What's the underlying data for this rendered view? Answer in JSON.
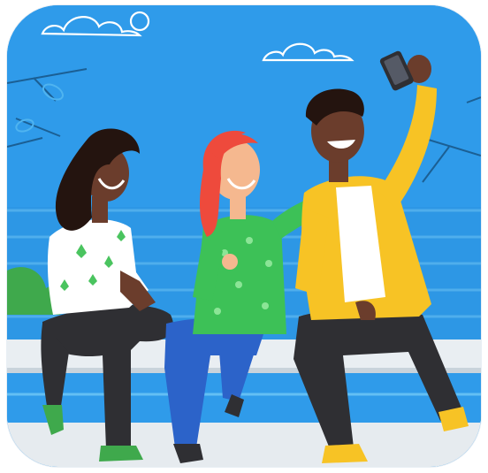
{
  "app_icon": {
    "name": "selfie-illustration-app-icon",
    "colors": {
      "sky": "#2f9bea",
      "water_line": "#5cb8f2",
      "bench": "#e9eef2",
      "shrub": "#3fa94c",
      "skin_dark": "#6b3d2c",
      "skin_light": "#f5b88f",
      "hair_red": "#ee4a3c",
      "shirt_green": "#3dc157",
      "jacket_yellow": "#f7c325",
      "pants_dark": "#2f2f33",
      "jeans_blue": "#2c63c9"
    },
    "people": [
      "woman-white-floral-shirt",
      "woman-red-hair-green-shirt",
      "man-yellow-jacket-taking-selfie"
    ],
    "icons": [
      "phone-icon",
      "cloud-icon",
      "cloud-icon"
    ]
  }
}
